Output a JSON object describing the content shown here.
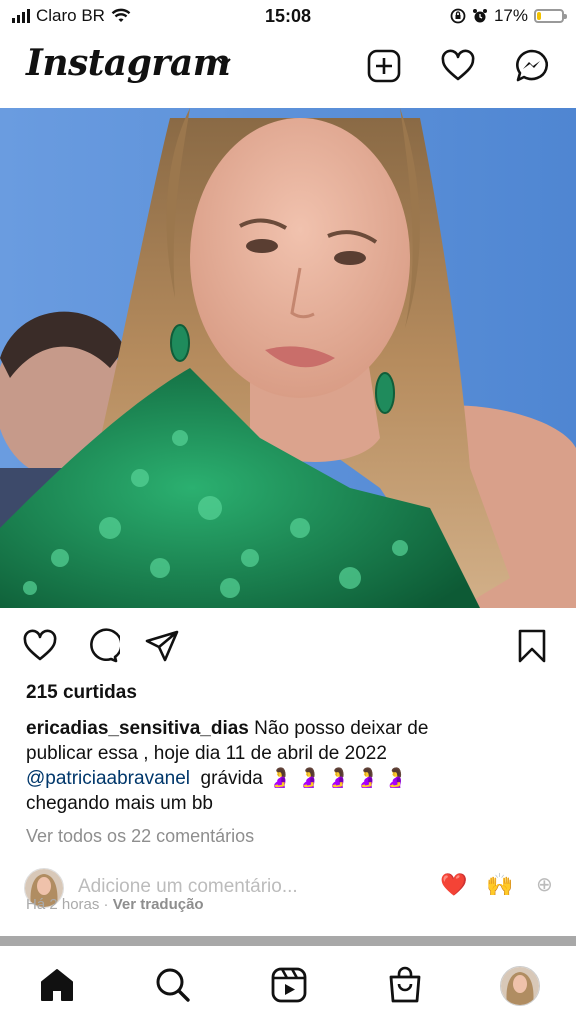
{
  "status_bar": {
    "carrier": "Claro BR",
    "time": "15:08",
    "battery": "17%",
    "battery_level": 0.17,
    "icons": [
      "signal-icon",
      "wifi-icon",
      "screen-lock-icon",
      "alarm-icon",
      "battery-icon"
    ]
  },
  "header": {
    "logo": "Instagram",
    "icons": [
      "chevron-down-icon",
      "new-post-icon",
      "activity-heart-icon",
      "messenger-icon"
    ]
  },
  "post": {
    "photo": "photo of a woman with long wavy hair in a green sequin one-shoulder dress against a blue background",
    "action_icons": [
      "like-icon",
      "comment-icon",
      "share-icon",
      "save-icon"
    ],
    "likes": "215 curtidas",
    "caption": {
      "username": "ericadias_sensitiva_dias",
      "text_line1": " Não posso deixar de",
      "text_line2": "publicar essa , hoje dia 11 de abril de 2022",
      "mention": "@patriciaabravanel",
      "text_after_mention": "  grávida ",
      "emojis": "🤰 🤰 🤰 🤰 🤰",
      "text_line4": "chegando mais um bb"
    },
    "view_comments": "Ver todos os 22 comentários",
    "comment_placeholder": "Adicione um comentário...",
    "quick_reactions": [
      "❤️",
      "🙌",
      "⊕"
    ],
    "time_ago": "Há 2 horas",
    "separator": "·",
    "translate": "Ver tradução"
  },
  "tab_bar": {
    "items": [
      "home-icon",
      "search-icon",
      "reels-icon",
      "shop-icon",
      "profile-avatar"
    ]
  },
  "colors": {
    "mention": "#00376b",
    "muted": "#8e8e8e",
    "text": "#111111"
  }
}
